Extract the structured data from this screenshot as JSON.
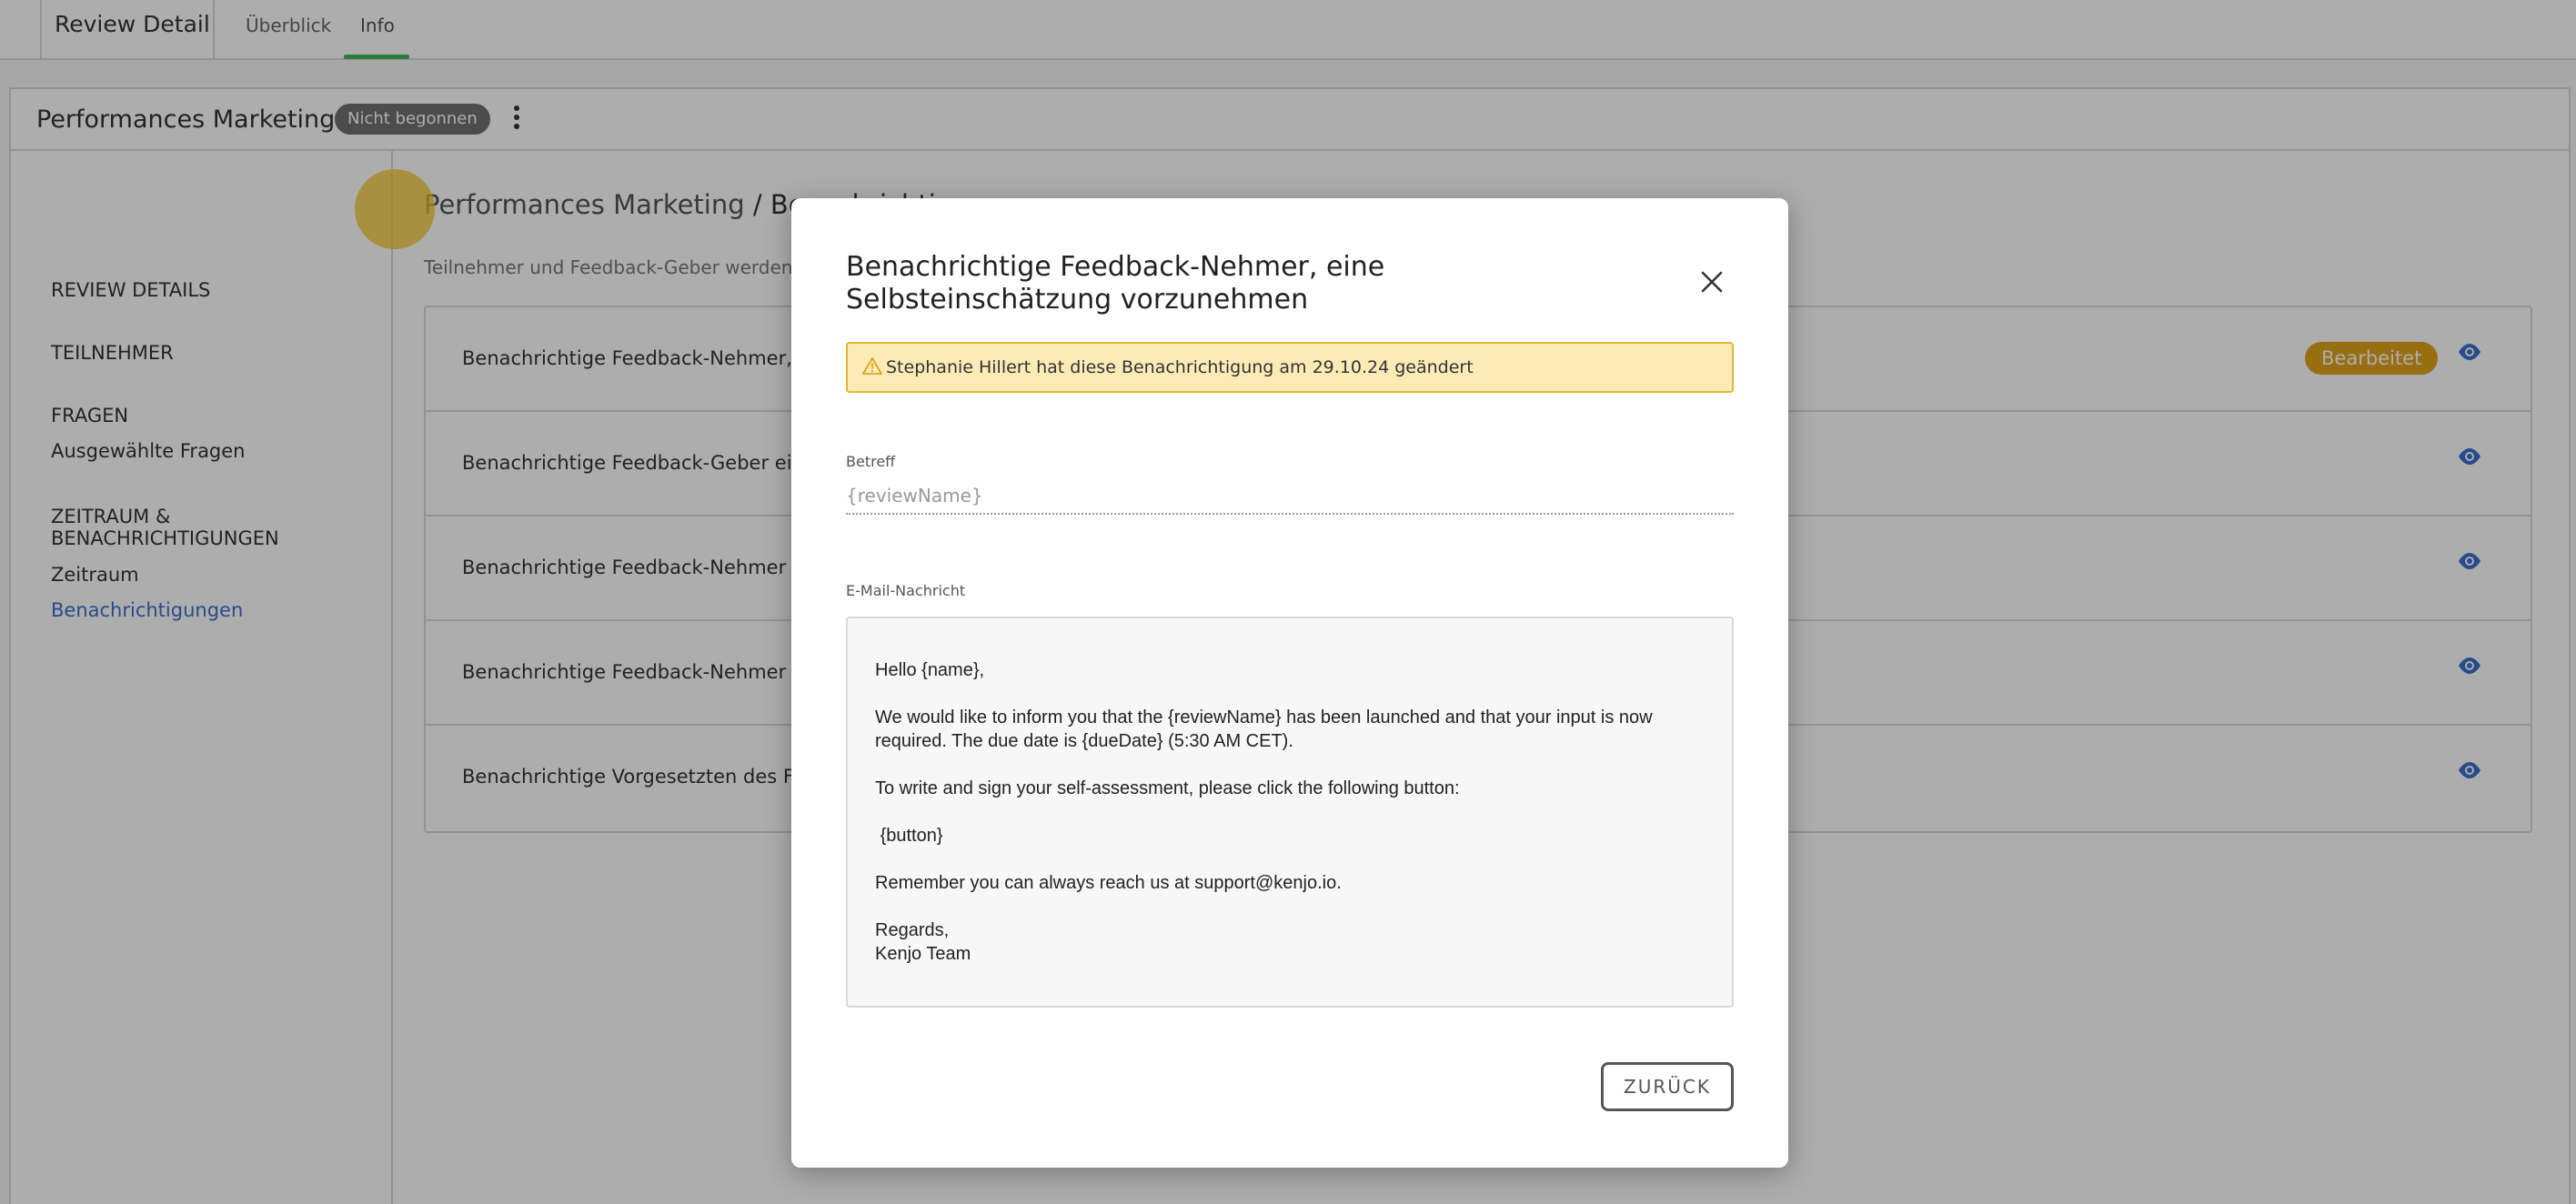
{
  "topbar": {
    "title": "Review Detail",
    "tabs": [
      {
        "label": "Überblick"
      },
      {
        "label": "Info"
      }
    ]
  },
  "review": {
    "name": "Performances Marketing",
    "status_badge": "Nicht begonnen"
  },
  "sidebar": {
    "items": [
      {
        "label": "REVIEW DETAILS"
      },
      {
        "label": "TEILNEHMER"
      },
      {
        "label": "FRAGEN"
      },
      {
        "label": "Ausgewählte Fragen"
      },
      {
        "label": "ZEITRAUM &"
      },
      {
        "label": "BENACHRICHTIGUNGEN"
      },
      {
        "label": "Zeitraum"
      },
      {
        "label": "Benachrichtigungen"
      }
    ]
  },
  "content": {
    "breadcrumb_parent": "Performances Marketing",
    "breadcrumb_current": " / Benachrichtigungen",
    "description": "Teilnehmer und Feedback-Geber werden",
    "rows": [
      {
        "label": "Benachrichtige Feedback-Nehmer, eine Selbsteinschätzung vorzunehmen",
        "badge": "Bearbeitet"
      },
      {
        "label": "Benachrichtige Feedback-Geber ein Feedback abzugeben"
      },
      {
        "label": "Benachrichtige Feedback-Nehmer wenn"
      },
      {
        "label": "Benachrichtige Feedback-Nehmer oder"
      },
      {
        "label": "Benachrichtige Vorgesetzten des Feedback-Nehmers"
      }
    ]
  },
  "modal": {
    "title": "Benachrichtige Feedback-Nehmer, eine Selbsteinschätzung vorzunehmen",
    "warning": "Stephanie Hillert hat diese Benachrichtigung am 29.10.24 geändert",
    "subject_label": "Betreff",
    "subject_placeholder": "{reviewName}",
    "message_label": "E-Mail-Nachricht",
    "message": {
      "greeting": "Hello {name},",
      "line1": "We would like to inform you that the {reviewName} has been launched and that your input is now required. The due date is {dueDate} (5:30 AM CET).",
      "line2": "To write and sign your self-assessment, please click the following button:",
      "button_token": " {button}",
      "line3": "Remember you can always reach us at support@kenjo.io.",
      "regards": "Regards,",
      "signature": "Kenjo Team"
    },
    "back_button": "ZURÜCK"
  },
  "colors": {
    "accent_green": "#3fb65a",
    "link_blue": "#3b6fcf",
    "edited_badge": "#e0a21d",
    "warning_bg": "#fdebb6",
    "warning_border": "#e5b52f"
  }
}
